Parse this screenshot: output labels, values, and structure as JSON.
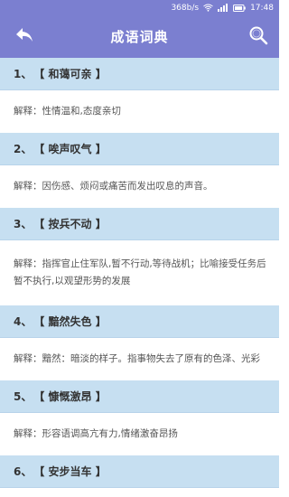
{
  "status_bar": {
    "speed": "368b/s",
    "time": "17:48"
  },
  "app_bar": {
    "title": "成语词典",
    "back_icon": "back-arrow-icon",
    "search_icon": "search-icon",
    "background_color": "#7b7fd0"
  },
  "entries": [
    {
      "index": "1、",
      "word": "【 和蔼可亲 】",
      "explanation": "解释：性情温和,态度亲切"
    },
    {
      "index": "2、",
      "word": "【 唉声叹气 】",
      "explanation": "解释：因伤感、烦闷或痛苦而发出叹息的声音。"
    },
    {
      "index": "3、",
      "word": "【 按兵不动 】",
      "explanation": "解释：指挥官止住军队,暂不行动,等待战机；比喻接受任务后暂不执行,以观望形势的发展"
    },
    {
      "index": "4、",
      "word": "【 黯然失色 】",
      "explanation": "解释：黯然：暗淡的样子。指事物失去了原有的色泽、光彩"
    },
    {
      "index": "5、",
      "word": "【 慷慨激昂 】",
      "explanation": "解释：形容语调高亢有力,情绪激奋昂扬"
    },
    {
      "index": "6、",
      "word": "【 安步当车 】",
      "explanation": ""
    }
  ]
}
